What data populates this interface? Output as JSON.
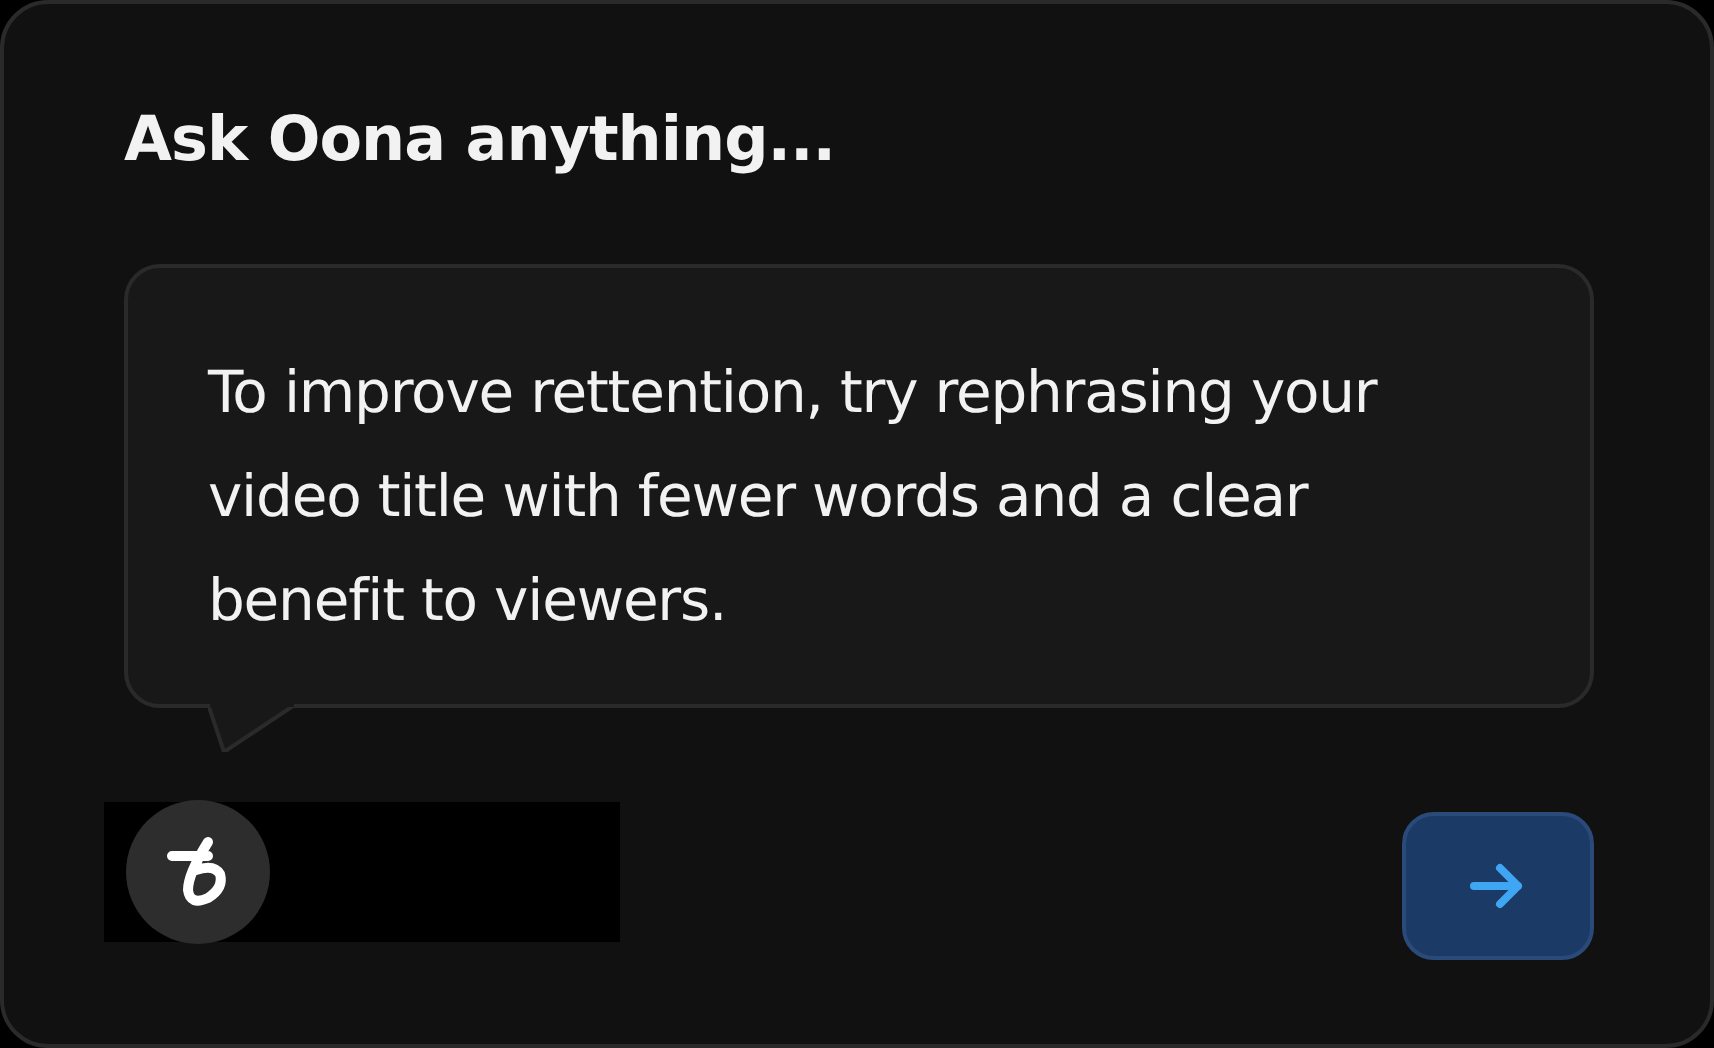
{
  "title": "Ask Oona anything...",
  "message": {
    "text": "To improve rettention, try rephrasing your video title with fewer words and a clear benefit to viewers."
  },
  "send_button": {
    "kind": "arrow"
  }
}
